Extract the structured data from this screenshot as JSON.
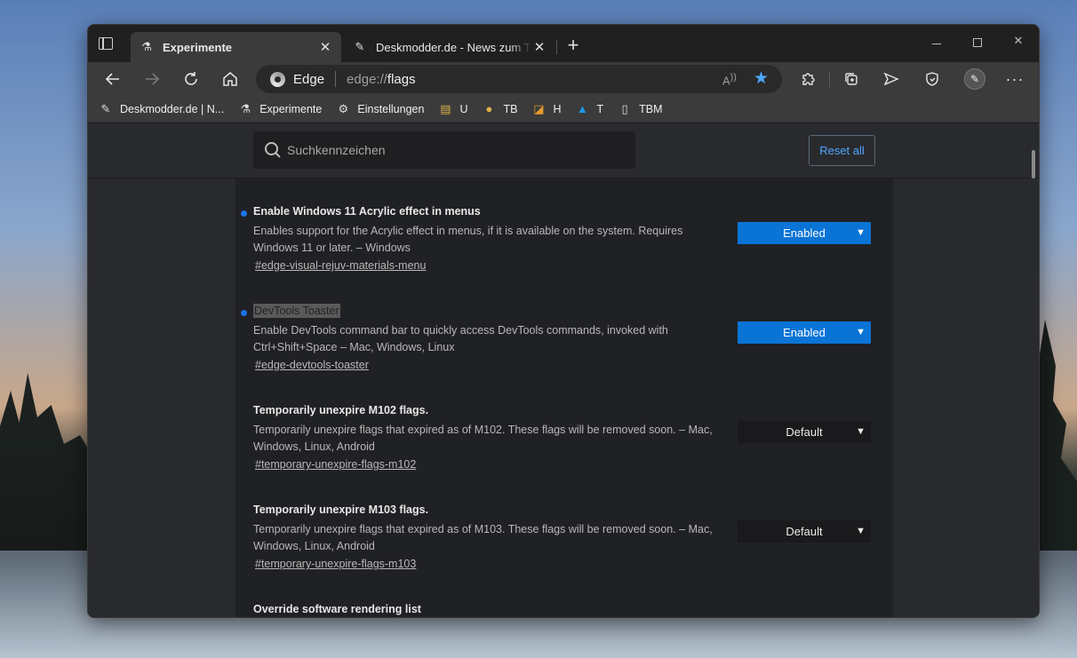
{
  "tabs": [
    {
      "title": "Experimente",
      "icon": "flask-icon",
      "active": true
    },
    {
      "title": "Deskmodder.de - News zum The",
      "icon": "deskmodder-icon",
      "active": false
    }
  ],
  "toolbar": {
    "brand": "Edge",
    "url_scheme": "edge://",
    "url_path": "flags"
  },
  "bookmarks": [
    {
      "label": "Deskmodder.de | N...",
      "icon": "deskmodder-icon"
    },
    {
      "label": "Experimente",
      "icon": "flask-icon"
    },
    {
      "label": "Einstellungen",
      "icon": "gear-icon"
    },
    {
      "label": "U",
      "icon": "folder-u-icon"
    },
    {
      "label": "TB",
      "icon": "tb-icon"
    },
    {
      "label": "H",
      "icon": "h-icon"
    },
    {
      "label": "T",
      "icon": "twitter-icon"
    },
    {
      "label": "TBM",
      "icon": "page-icon"
    }
  ],
  "search": {
    "placeholder": "Suchkennzeichen"
  },
  "reset_label": "Reset all",
  "flags": [
    {
      "title": "Enable Windows 11 Acrylic effect in menus",
      "desc": "Enables support for the Acrylic effect in menus, if it is available on the system. Requires Windows 11 or later. – Windows",
      "link": "#edge-visual-rejuv-materials-menu",
      "value": "Enabled",
      "modified": true
    },
    {
      "title": "DevTools Toaster",
      "desc": "Enable DevTools command bar to quickly access DevTools commands, invoked with Ctrl+Shift+Space – Mac, Windows, Linux",
      "link": "#edge-devtools-toaster",
      "value": "Enabled",
      "modified": true
    },
    {
      "title": "Temporarily unexpire M102 flags.",
      "desc": "Temporarily unexpire flags that expired as of M102. These flags will be removed soon. – Mac, Windows, Linux, Android",
      "link": "#temporary-unexpire-flags-m102",
      "value": "Default",
      "modified": false
    },
    {
      "title": "Temporarily unexpire M103 flags.",
      "desc": "Temporarily unexpire flags that expired as of M103. These flags will be removed soon. – Mac, Windows, Linux, Android",
      "link": "#temporary-unexpire-flags-m103",
      "value": "Default",
      "modified": false
    },
    {
      "title": "Override software rendering list"
    }
  ],
  "colors": {
    "accent": "#0a74d6",
    "link_blue": "#4ea7ff",
    "modified_dot": "#1a73e8"
  }
}
